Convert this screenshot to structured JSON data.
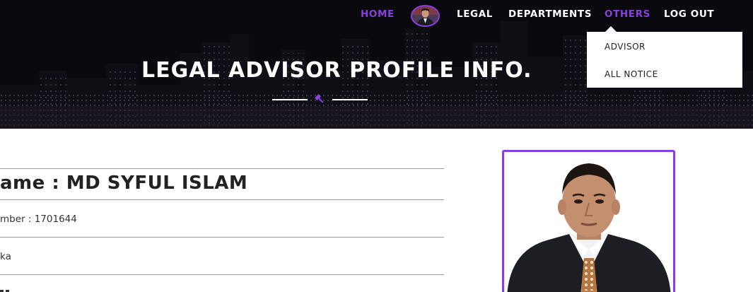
{
  "nav": {
    "items": [
      {
        "label": "HOME",
        "active": true
      },
      {
        "label": "LEGAL",
        "active": false
      },
      {
        "label": "DEPARTMENTS",
        "active": false
      },
      {
        "label": "OTHERS",
        "active": true
      },
      {
        "label": "LOG OUT",
        "active": false
      }
    ],
    "avatar_icon": "user-avatar",
    "accent_color": "#8a3fe0"
  },
  "dropdown": {
    "items": [
      "ADVISOR",
      "ALL NOTICE"
    ]
  },
  "hero": {
    "title": "LEGAL ADVISOR PROFILE INFO.",
    "divider_icon": "gavel-icon"
  },
  "profile": {
    "name_line": "ame : MD SYFUL ISLAM",
    "number_line": "mber : 1701644",
    "location_line": "ka"
  },
  "photo": {
    "icon": "profile-photo",
    "border_color": "#8a3fe0"
  }
}
